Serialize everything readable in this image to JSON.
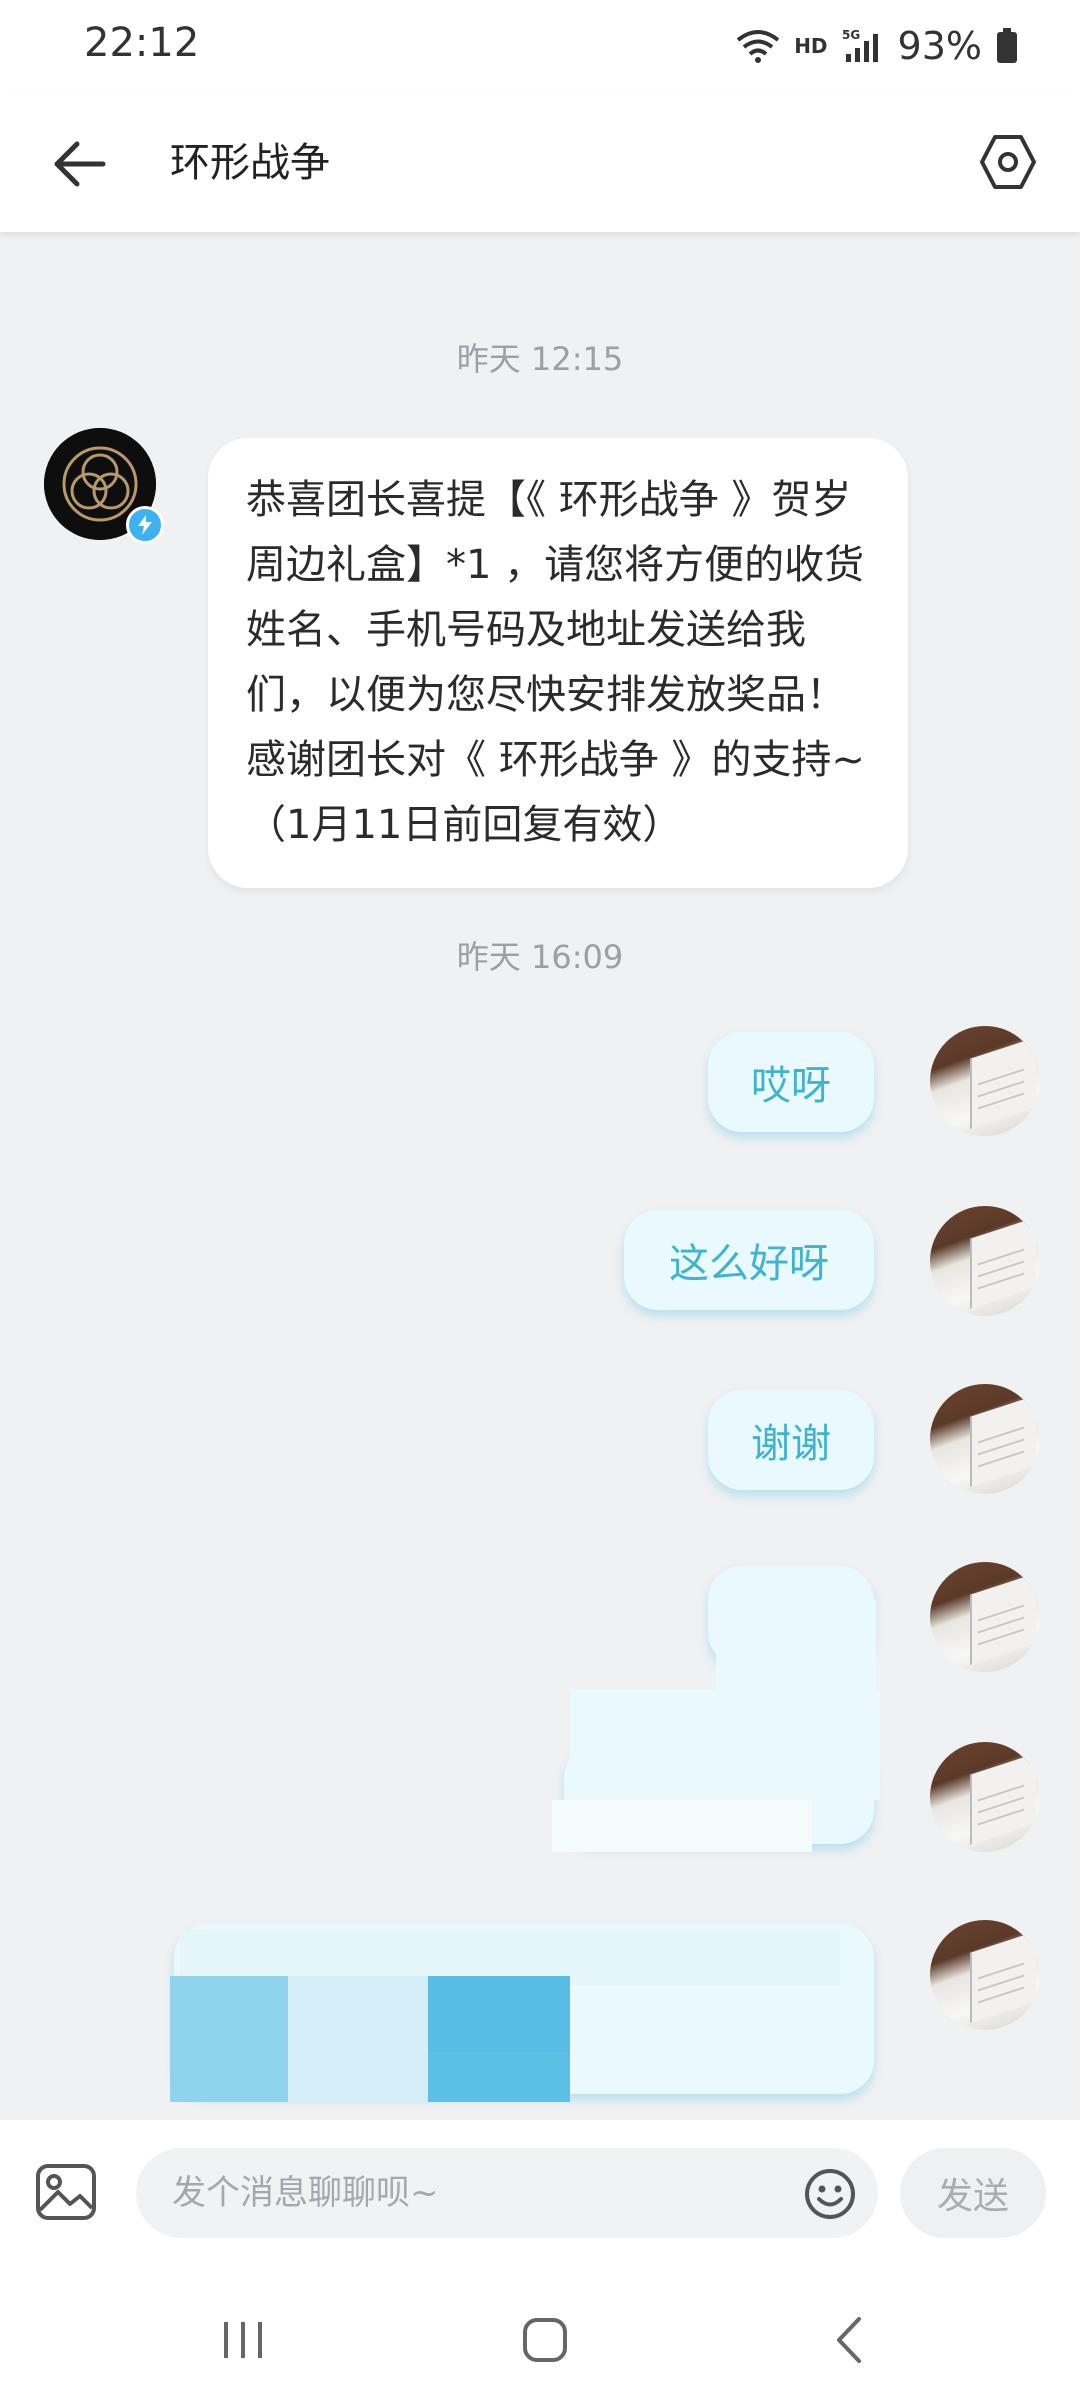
{
  "status_bar": {
    "time": "22:12",
    "network_label": "HD",
    "signal_label": "5G",
    "battery": "93%"
  },
  "header": {
    "title": "环形战争",
    "back_icon": "arrow-left-icon",
    "settings_icon": "hexagon-settings-icon"
  },
  "messages": {
    "timestamp_1": "昨天 12:15",
    "incoming_text": "恭喜团长喜提【《 环形战争 》贺岁周边礼盒】*1 ，请您将方便的收货姓名、手机号码及地址发送给我们，以便为您尽快安排发放奖品！感谢团长对《 环形战争 》的支持~（1月11日前回复有效）",
    "timestamp_2": "昨天 16:09",
    "outgoing": [
      "哎呀",
      "这么好呀",
      "谢谢"
    ]
  },
  "input_bar": {
    "placeholder": "发个消息聊聊呗~",
    "send_label": "发送",
    "image_icon": "image-icon",
    "emoji_icon": "smiley-icon"
  },
  "nav_bar": {
    "recent_icon": "recent-apps-icon",
    "home_icon": "home-icon",
    "back_icon": "nav-back-icon"
  },
  "colors": {
    "accent_text": "#3fb4cf",
    "outgoing_bubble": "#eaf9fd",
    "background": "#f0f1f3",
    "badge": "#3db2f0"
  }
}
